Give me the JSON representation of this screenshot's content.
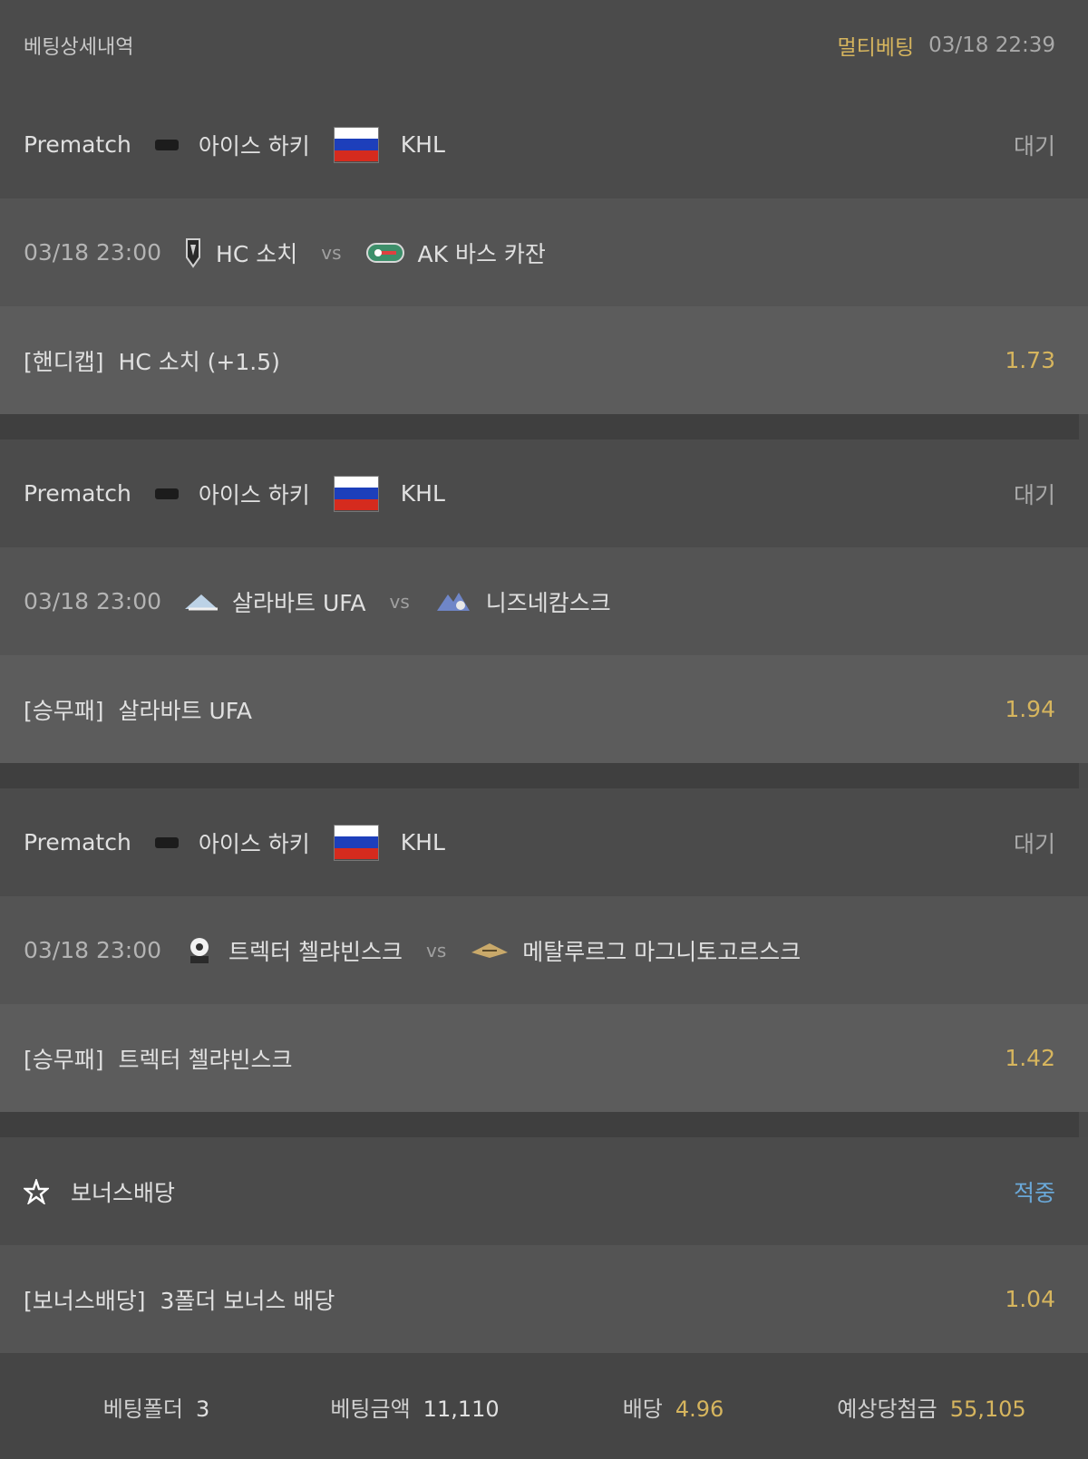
{
  "header": {
    "title": "베팅상세내역",
    "type": "멀티베팅",
    "datetime": "03/18 22:39"
  },
  "bets": [
    {
      "stage": "Prematch",
      "sport": "아이스 하키",
      "league": "KHL",
      "status": "대기",
      "time": "03/18 23:00",
      "home": "HC 소치",
      "vs": "vs",
      "away": "AK 바스 카잔",
      "market": "[핸디캡]",
      "pick": "HC 소치 (+1.5)",
      "odds": "1.73"
    },
    {
      "stage": "Prematch",
      "sport": "아이스 하키",
      "league": "KHL",
      "status": "대기",
      "time": "03/18 23:00",
      "home": "살라바트 UFA",
      "vs": "vs",
      "away": "니즈네캄스크",
      "market": "[승무패]",
      "pick": "살라바트 UFA",
      "odds": "1.94"
    },
    {
      "stage": "Prematch",
      "sport": "아이스 하키",
      "league": "KHL",
      "status": "대기",
      "time": "03/18 23:00",
      "home": "트렉터 첼랴빈스크",
      "vs": "vs",
      "away": "메탈루르그 마그니토고르스크",
      "market": "[승무패]",
      "pick": "트렉터 첼랴빈스크",
      "odds": "1.42"
    }
  ],
  "bonus": {
    "label": "보너스배당",
    "status": "적중",
    "market": "[보너스배당]",
    "pick": "3폴더 보너스 배당",
    "odds": "1.04"
  },
  "summary": {
    "folder_label": "베팅폴더",
    "folder_value": "3",
    "amount_label": "베팅금액",
    "amount_value": "11,110",
    "odds_label": "배당",
    "odds_value": "4.96",
    "payout_label": "예상당첨금",
    "payout_value": "55,105"
  },
  "colors": {
    "gold": "#d6b55e",
    "green": "#6fb39a",
    "blue": "#6aa8d8",
    "bg": "#4a4a4a"
  }
}
